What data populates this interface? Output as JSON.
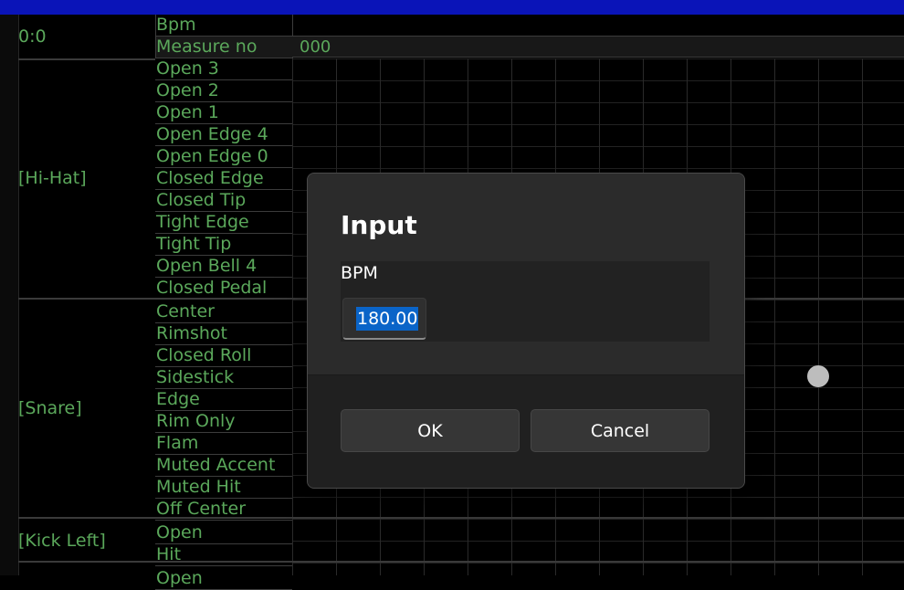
{
  "header": {
    "time": "0:0",
    "bpm_label": "Bpm",
    "measure_label": "Measure no",
    "measure_value": "000"
  },
  "groups": [
    {
      "name": "[Hi-Hat]"
    },
    {
      "name": "[Snare]"
    },
    {
      "name": "[Kick Left]"
    }
  ],
  "rows": [
    "Open 3",
    "Open 2",
    "Open 1",
    "Open Edge 4",
    "Open Edge 0",
    "Closed Edge",
    "Closed Tip",
    "Tight Edge",
    "Tight Tip",
    "Open Bell 4",
    "Closed Pedal",
    "Center",
    "Rimshot",
    "Closed Roll",
    "Sidestick",
    "Edge",
    "Rim Only",
    "Flam",
    "Muted Accent",
    "Muted Hit",
    "Off Center",
    "Open",
    "Hit",
    "Open"
  ],
  "dialog": {
    "title": "Input",
    "field_label": "BPM",
    "field_value": "180.00",
    "ok_label": "OK",
    "cancel_label": "Cancel"
  },
  "colors": {
    "title_bar": "#0a14b8",
    "label_text": "#5ba85b",
    "selection": "#0a64c8"
  }
}
